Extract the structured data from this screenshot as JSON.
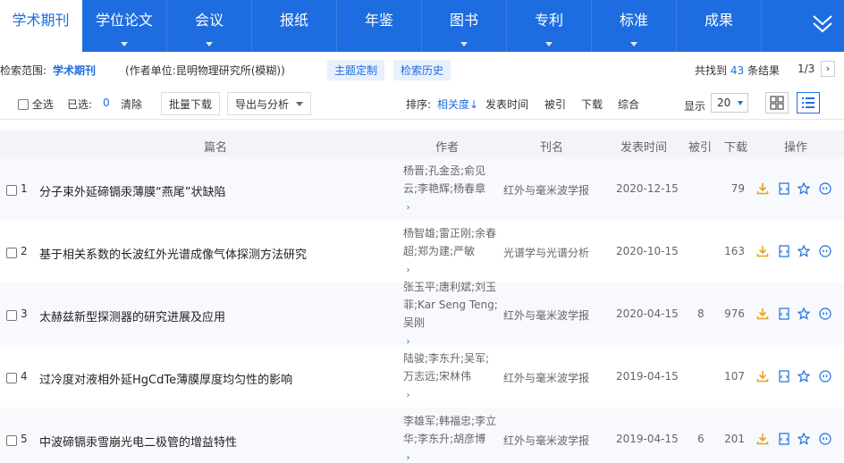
{
  "nav": {
    "tabs": [
      {
        "label": "学术期刊",
        "active": true,
        "caret": false
      },
      {
        "label": "学位论文",
        "active": false,
        "caret": true
      },
      {
        "label": "会议",
        "active": false,
        "caret": true
      },
      {
        "label": "报纸",
        "active": false,
        "caret": false
      },
      {
        "label": "年鉴",
        "active": false,
        "caret": false
      },
      {
        "label": "图书",
        "active": false,
        "caret": true
      },
      {
        "label": "专利",
        "active": false,
        "caret": true
      },
      {
        "label": "标准",
        "active": false,
        "caret": true
      },
      {
        "label": "成果",
        "active": false,
        "caret": false
      }
    ]
  },
  "scope": {
    "label": "检索范围:",
    "value": "学术期刊",
    "condition": "(作者单位:昆明物理研究所(模糊))",
    "topic_btn": "主题定制",
    "history_btn": "检索历史",
    "found_prefix": "共找到",
    "found_count": "43",
    "found_suffix": "条结果",
    "page": "1/3"
  },
  "toolbar": {
    "select_all": "全选",
    "selected_label": "已选:",
    "selected_count": "0",
    "clear": "清除",
    "batch_download": "批量下载",
    "export": "导出与分析",
    "sort_label": "排序:",
    "sort_relevance": "相关度",
    "sort_date": "发表时间",
    "sort_cited": "被引",
    "sort_download": "下载",
    "sort_overall": "综合",
    "display_label": "显示",
    "display_count": "20"
  },
  "table": {
    "headers": {
      "title": "篇名",
      "author": "作者",
      "journal": "刊名",
      "date": "发表时间",
      "cited": "被引",
      "download": "下载",
      "ops": "操作"
    },
    "rows": [
      {
        "num": "1",
        "title": "分子束外延碲镉汞薄膜“燕尾”状缺陷",
        "authors": [
          "杨晋;孔金丞;俞见",
          "云;李艳辉;杨春章"
        ],
        "journal": "红外与毫米波学报",
        "date": "2020-12-15",
        "cited": "",
        "downloads": "79"
      },
      {
        "num": "2",
        "title": "基于相关系数的长波红外光谱成像气体探测方法研究",
        "authors": [
          "杨智雄;雷正刚;余春",
          "超;郑为建;严敏"
        ],
        "journal": "光谱学与光谱分析",
        "date": "2020-10-15",
        "cited": "",
        "downloads": "163"
      },
      {
        "num": "3",
        "title": "太赫兹新型探测器的研究进展及应用",
        "authors": [
          "张玉平;唐利斌;刘玉",
          "菲;Kar Seng Teng;",
          "吴刚"
        ],
        "journal": "红外与毫米波学报",
        "date": "2020-04-15",
        "cited": "8",
        "downloads": "976"
      },
      {
        "num": "4",
        "title": "过冷度对液相外延HgCdTe薄膜厚度均匀性的影响",
        "authors": [
          "陆骏;李东升;吴军;",
          "万志远;宋林伟"
        ],
        "journal": "红外与毫米波学报",
        "date": "2019-04-15",
        "cited": "",
        "downloads": "107"
      },
      {
        "num": "5",
        "title": "中波碲镉汞雪崩光电二极管的增益特性",
        "authors": [
          "李雄军;韩福忠;李立",
          "华;李东升;胡彦博"
        ],
        "journal": "红外与毫米波学报",
        "date": "2019-04-15",
        "cited": "6",
        "downloads": "201"
      }
    ]
  },
  "colors": {
    "primary": "#1e6de0",
    "download_icon": "#e8a317",
    "ops_icon": "#1e6de0"
  }
}
